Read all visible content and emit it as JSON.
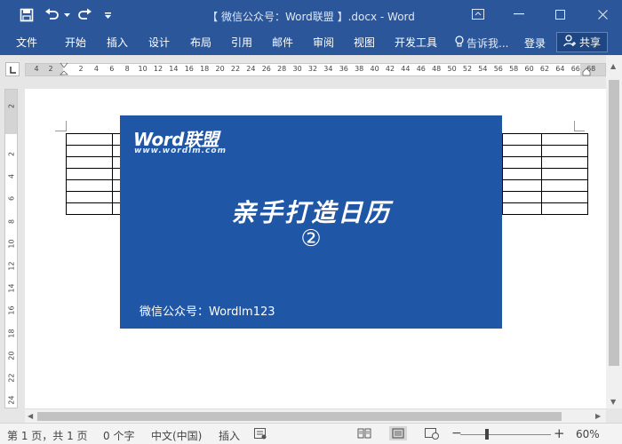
{
  "titlebar": {
    "title": "【 微信公众号：Word联盟 】.docx - Word",
    "bg_color": "#2b579a"
  },
  "ribbon": {
    "file": "文件",
    "tabs": [
      "开始",
      "插入",
      "设计",
      "布局",
      "引用",
      "邮件",
      "审阅",
      "视图",
      "开发工具"
    ],
    "tell_me": "告诉我...",
    "login": "登录",
    "share": "共享"
  },
  "ruler": {
    "h_ticks": [
      "4",
      "2",
      "2",
      "4",
      "6",
      "8",
      "10",
      "12",
      "14",
      "16",
      "18",
      "20",
      "22",
      "24",
      "26",
      "28",
      "30",
      "32",
      "34",
      "36",
      "38",
      "40",
      "42",
      "44",
      "46",
      "48",
      "50",
      "52",
      "54",
      "56",
      "58",
      "60",
      "62",
      "64",
      "66",
      "68"
    ],
    "v_ticks": [
      "2",
      "2",
      "4",
      "6",
      "8",
      "10",
      "12",
      "14",
      "16",
      "18",
      "20",
      "22",
      "24"
    ]
  },
  "banner": {
    "logo": "Word联盟",
    "url": "www.wordlm.com",
    "title": "亲手打造日历",
    "number": "②",
    "wechat": "微信公众号：Wordlm123",
    "bg_color": "#1f56a6"
  },
  "statusbar": {
    "page": "第 1 页，共 1 页",
    "words": "0 个字",
    "language": "中文(中国)",
    "mode": "插入",
    "zoom": "60%"
  }
}
